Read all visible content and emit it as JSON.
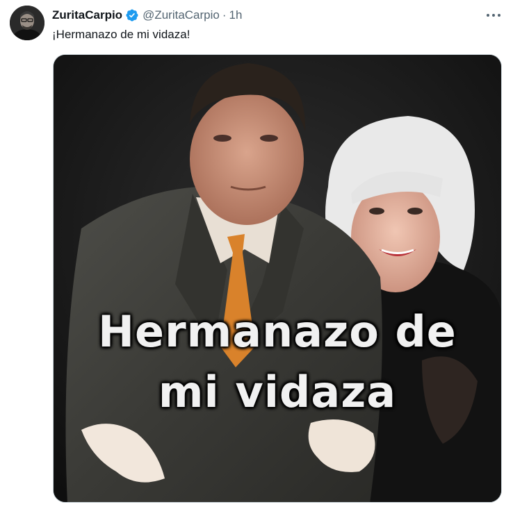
{
  "tweet": {
    "display_name": "ZuritaCarpio",
    "handle": "@ZuritaCarpio",
    "separator": "·",
    "timestamp": "1h",
    "text": "¡Hermanazo de mi vidaza!"
  },
  "media": {
    "caption_line1": "Hermanazo de",
    "caption_line2": "mi vidaza"
  },
  "icons": {
    "verified": "verified-badge-icon",
    "more": "more-options-icon"
  },
  "colors": {
    "verified_blue": "#1d9bf0",
    "secondary_text": "#536471",
    "primary_text": "#0f1419"
  }
}
